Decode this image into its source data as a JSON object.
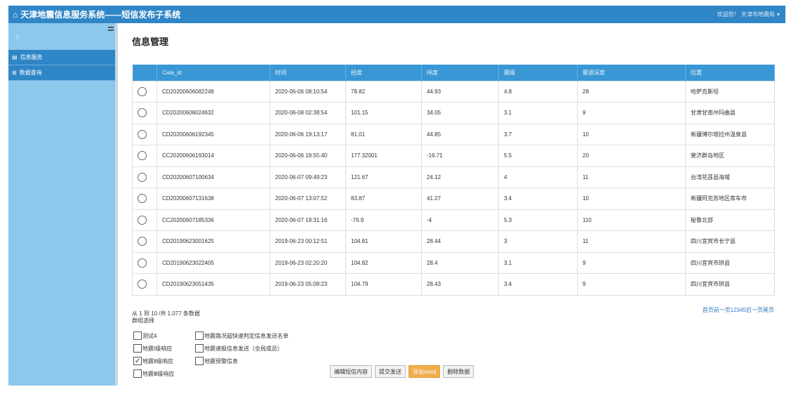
{
  "app": {
    "title": "天津地震信息服务系统——短信发布子系统",
    "user_text": "欢迎您！ 天津市地震局"
  },
  "sidebar": {
    "items": [
      {
        "label": "信息服务",
        "icon": "list-icon"
      },
      {
        "label": "数据查询",
        "icon": "grid-icon"
      }
    ]
  },
  "main": {
    "page_title": "信息管理"
  },
  "table": {
    "columns": [
      "",
      "Cata_id",
      "时间",
      "经度",
      "纬度",
      "震级",
      "震源深度",
      "位置"
    ],
    "rows": [
      [
        "CD20200606082248",
        "2020-06-06 08:10:54",
        "78.82",
        "44.93",
        "4.8",
        "28",
        "哈萨克斯坦"
      ],
      [
        "CD20200608024632",
        "2020-06-08 02:38:54",
        "101.15",
        "34.05",
        "3.1",
        "9",
        "甘肃甘南州玛曲县"
      ],
      [
        "CD20200606192345",
        "2020-06-06 19:13:17",
        "81.01",
        "44.85",
        "3.7",
        "10",
        "新疆博尔塔拉州温泉县"
      ],
      [
        "CC20200606193014",
        "2020-06-06 18:55:40",
        "177.32001",
        "-16.71",
        "5.5",
        "20",
        "斐济群岛地区"
      ],
      [
        "CD20200607100634",
        "2020-06-07 09:49:23",
        "121.67",
        "24.12",
        "4",
        "11",
        "台湾花莲县海域"
      ],
      [
        "CD20200607131638",
        "2020-06-07 13:07:52",
        "83.87",
        "41.27",
        "3.4",
        "10",
        "新疆阿克苏地区库车市"
      ],
      [
        "CC20200607185336",
        "2020-06-07 18:31:16",
        "-76.9",
        "-4",
        "5.3",
        "110",
        "秘鲁北部"
      ],
      [
        "CD20190623001625",
        "2019-06-23 00:12:51",
        "104.81",
        "28.44",
        "3",
        "11",
        "四川宜宾市长宁县"
      ],
      [
        "CD20190623022405",
        "2019-06-23 02:20:20",
        "104.82",
        "28.4",
        "3.1",
        "9",
        "四川宜宾市珙县"
      ],
      [
        "CD20190623051435",
        "2019-06-23 05:08:23",
        "104.79",
        "28.43",
        "3.4",
        "9",
        "四川宜宾市珙县"
      ]
    ]
  },
  "footer": {
    "row_count": "从 1 到 10 /共 1,077 条数据",
    "pager": "首页前一页12345后一页尾页"
  },
  "groups": {
    "label": "群组选择",
    "items": [
      {
        "label": "测试4",
        "checked": false
      },
      {
        "label": "地震路况超快速判定信息发送名单",
        "checked": false
      },
      {
        "label": "地震Ⅰ级响应",
        "checked": false
      },
      {
        "label": "地震速报信息发送（全局成员）",
        "checked": false
      },
      {
        "label": "地震Ⅱ级响应",
        "checked": true
      },
      {
        "label": "地震预警信息",
        "checked": false
      },
      {
        "label": "地震Ⅲ级响应",
        "checked": false
      }
    ]
  },
  "buttons": {
    "edit": "编辑短信内容",
    "submit": "提交发送",
    "export_word": "导出word",
    "delete": "删除数据"
  }
}
